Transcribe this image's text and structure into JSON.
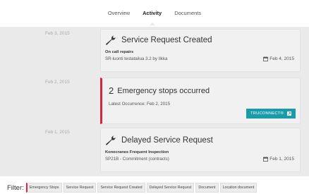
{
  "tabs": [
    {
      "label": "Overview"
    },
    {
      "label": "Activity"
    },
    {
      "label": "Documents"
    }
  ],
  "timeline": [
    {
      "date": "Feb 3, 2015",
      "title": "Service Request Created",
      "subtitle": "On call repairs",
      "detail": "SR-luonti testatailua 3.2 by Ilkka",
      "event_date": "Feb 4, 2015",
      "icon": "wrench-icon"
    },
    {
      "date": "Feb 2, 2015",
      "count": "2",
      "title": "Emergency stops occurred",
      "detail": "Latest Occurrence: Feb 2, 2015",
      "button": "TRUCONNECT®",
      "accent": "#d7263d",
      "button_color": "#1a9bab"
    },
    {
      "date": "Feb 1, 2015",
      "title": "Delayed Service Request",
      "subtitle": "Konecranes Frequent Inspection",
      "detail": "SP21B - Commitment (contracts)",
      "event_date": "Feb 1, 2015",
      "icon": "wrench-icon"
    }
  ],
  "filter": {
    "label": "Filter:",
    "chips": [
      "Emergency Stops",
      "Service Request",
      "Service Request Created",
      "Delayed Service Request",
      "Document",
      "Location document"
    ]
  }
}
